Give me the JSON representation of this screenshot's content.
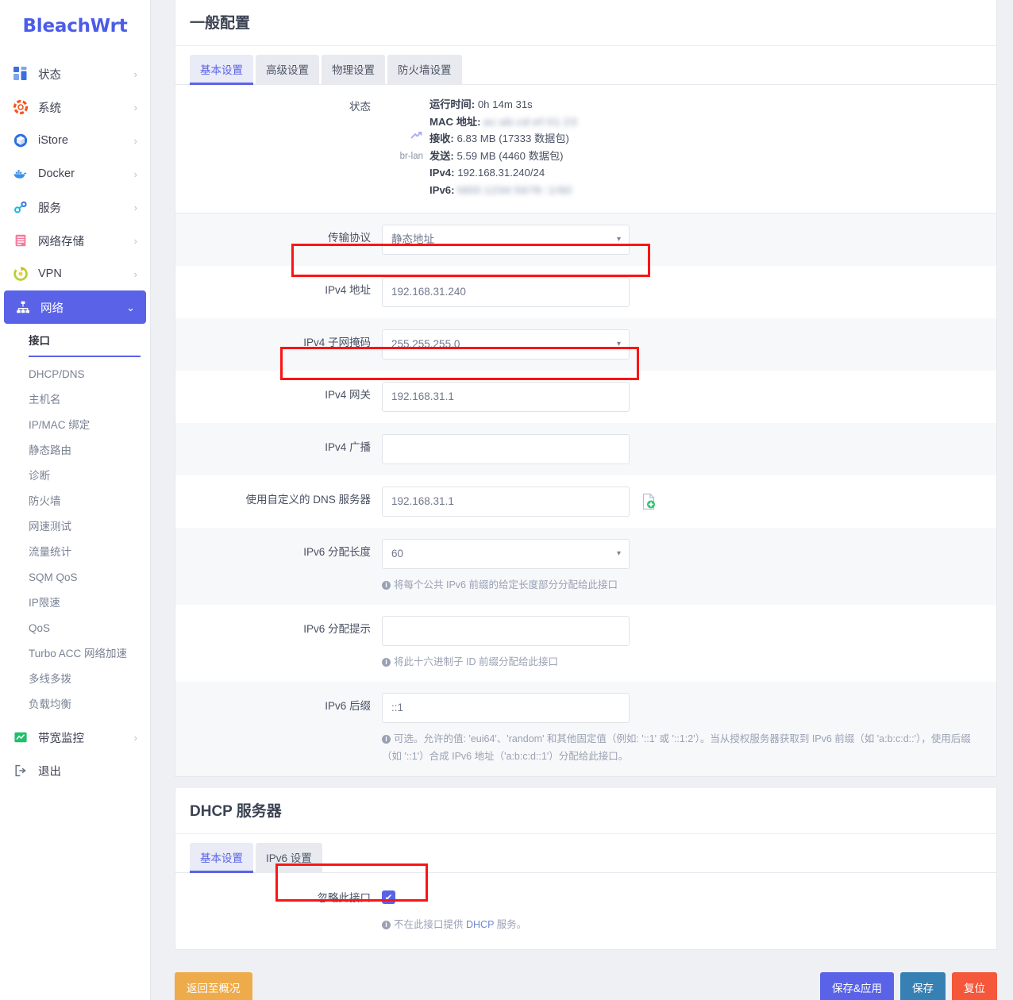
{
  "sidebar": {
    "brand": "BleachWrt",
    "items": [
      {
        "label": "状态",
        "icon": "grid-icon",
        "color": "#3b6fe0",
        "chevron": "›"
      },
      {
        "label": "系统",
        "icon": "gear-icon",
        "color": "#f4561f",
        "chevron": "›"
      },
      {
        "label": "iStore",
        "icon": "cube-icon",
        "color": "#2f6fe0",
        "chevron": "›"
      },
      {
        "label": "Docker",
        "icon": "whale-icon",
        "color": "#3d8fe8",
        "chevron": "›"
      },
      {
        "label": "服务",
        "icon": "link-icon",
        "color": "#19b6e8",
        "chevron": "›"
      },
      {
        "label": "网络存储",
        "icon": "storage-icon",
        "color": "#f57a9b",
        "chevron": "›"
      },
      {
        "label": "VPN",
        "icon": "shield-vpn-icon",
        "color": "#b8d235",
        "chevron": "›"
      }
    ],
    "active": {
      "label": "网络",
      "icon": "network-icon",
      "chevron": "⌄"
    },
    "subitems": [
      {
        "label": "接口",
        "selected": true
      },
      {
        "label": "DHCP/DNS",
        "selected": false
      },
      {
        "label": "主机名",
        "selected": false
      },
      {
        "label": "IP/MAC 绑定",
        "selected": false
      },
      {
        "label": "静态路由",
        "selected": false
      },
      {
        "label": "诊断",
        "selected": false
      },
      {
        "label": "防火墙",
        "selected": false
      },
      {
        "label": "网速测试",
        "selected": false
      },
      {
        "label": "流量统计",
        "selected": false
      },
      {
        "label": "SQM QoS",
        "selected": false
      },
      {
        "label": "IP限速",
        "selected": false
      },
      {
        "label": "QoS",
        "selected": false
      },
      {
        "label": "Turbo ACC 网络加速",
        "selected": false
      },
      {
        "label": "多线多拨",
        "selected": false
      },
      {
        "label": "负载均衡",
        "selected": false
      }
    ],
    "bandwidth": {
      "label": "带宽监控",
      "icon": "monitor-icon",
      "color": "#1fbf6b",
      "chevron": "›"
    },
    "logout": {
      "label": "退出",
      "icon": "logout-icon"
    }
  },
  "general": {
    "title": "一般配置",
    "tabs": [
      {
        "label": "基本设置",
        "active": true
      },
      {
        "label": "高级设置",
        "active": false
      },
      {
        "label": "物理设置",
        "active": false
      },
      {
        "label": "防火墙设置",
        "active": false
      }
    ],
    "status": {
      "label": "状态",
      "iface": "br-lan",
      "uptime_key": "运行时间:",
      "uptime_val": "0h 14m 31s",
      "mac_key": "MAC 地址:",
      "mac_val": "ac:ab:cd:ef:01:23",
      "rx_key": "接收:",
      "rx_val": "6.83 MB (17333 数据包)",
      "tx_key": "发送:",
      "tx_val": "5.59 MB (4460 数据包)",
      "ipv4_key": "IPv4:",
      "ipv4_val": "192.168.31.240/24",
      "ipv6_key": "IPv6:",
      "ipv6_val": "fd00:1234:5678::1/60"
    },
    "fields": {
      "proto_label": "传输协议",
      "proto_value": "静态地址",
      "ipv4addr_label": "IPv4 地址",
      "ipv4addr_value": "192.168.31.240",
      "netmask_label": "IPv4 子网掩码",
      "netmask_value": "255.255.255.0",
      "gateway_label": "IPv4 网关",
      "gateway_value": "192.168.31.1",
      "broadcast_label": "IPv4 广播",
      "broadcast_value": "",
      "dns_label": "使用自定义的 DNS 服务器",
      "dns_value": "192.168.31.1",
      "dns_add_icon": "add-page-icon",
      "ip6assign_label": "IPv6 分配长度",
      "ip6assign_value": "60",
      "ip6assign_hint": "将每个公共 IPv6 前缀的给定长度部分分配给此接口",
      "ip6hint_label": "IPv6 分配提示",
      "ip6hint_value": "",
      "ip6hint_hint": "将此十六进制子 ID 前缀分配给此接口",
      "ip6suffix_label": "IPv6 后缀",
      "ip6suffix_value": "::1",
      "ip6suffix_hint": "可选。允许的值: 'eui64'、'random' 和其他固定值（例如: '::1' 或 '::1:2'）。当从授权服务器获取到 IPv6 前缀（如 'a:b:c:d::'），使用后缀（如 '::1'）合成 IPv6 地址（'a:b:c:d::1'）分配给此接口。"
    }
  },
  "dhcp": {
    "title": "DHCP 服务器",
    "tabs": [
      {
        "label": "基本设置",
        "active": true
      },
      {
        "label": "IPv6 设置",
        "active": false
      }
    ],
    "ignore_label": "忽略此接口",
    "ignore_checked": true,
    "ignore_hint_pre": "不在此接口提供 ",
    "ignore_hint_link": "DHCP",
    "ignore_hint_post": " 服务。"
  },
  "footer": {
    "back": "返回至概况",
    "save_apply": "保存&应用",
    "save": "保存",
    "reset": "复位"
  },
  "colors": {
    "accent": "#5a63e8",
    "annotation": "#fc1414",
    "warning": "#eeab4b",
    "save": "#3780b4",
    "reset": "#f4573a"
  }
}
